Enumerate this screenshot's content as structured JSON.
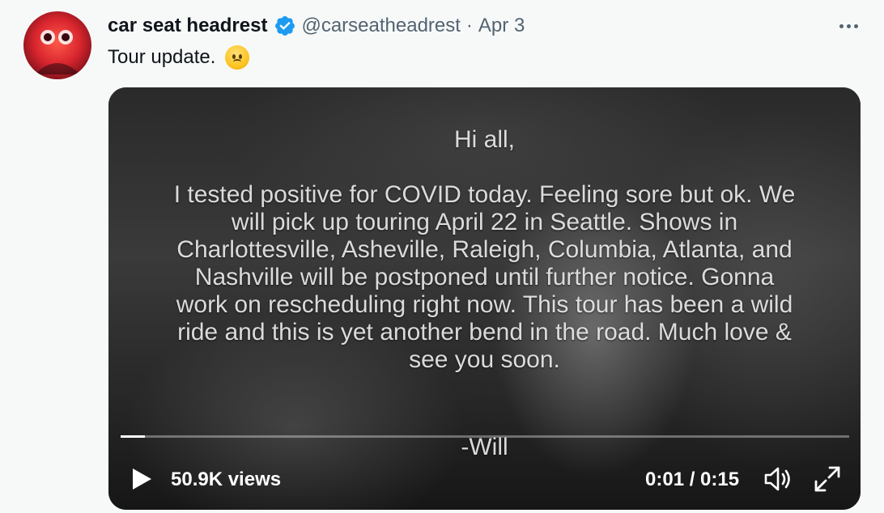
{
  "tweet": {
    "author_name": "car seat headrest",
    "handle": "@carseatheadrest",
    "separator": "·",
    "date": "Apr 3",
    "text": "Tour update.",
    "emoji": "worried-face-emoji"
  },
  "video": {
    "message_greeting": "Hi all,",
    "message_body": "I tested positive for COVID today. Feeling sore but ok. We will pick up touring April 22 in Seattle. Shows in Charlottesville, Asheville, Raleigh, Columbia, Atlanta, and Nashville will be postponed until further notice. Gonna work on rescheduling right now. This tour has been a wild ride and this is yet another bend in the road. Much love & see you soon.",
    "message_signoff": "-Will",
    "views": "50.9K views",
    "time_display": "0:01 / 0:15",
    "progress_fraction": 0.033
  },
  "colors": {
    "verified": "#1d9bf0",
    "muted_text": "#536471",
    "primary_text": "#0f1419",
    "background": "#f7f9f9"
  },
  "icons": {
    "more": "more-horizontal-icon",
    "verified": "verified-badge-icon",
    "play": "play-icon",
    "volume": "volume-icon",
    "fullscreen": "fullscreen-icon"
  }
}
